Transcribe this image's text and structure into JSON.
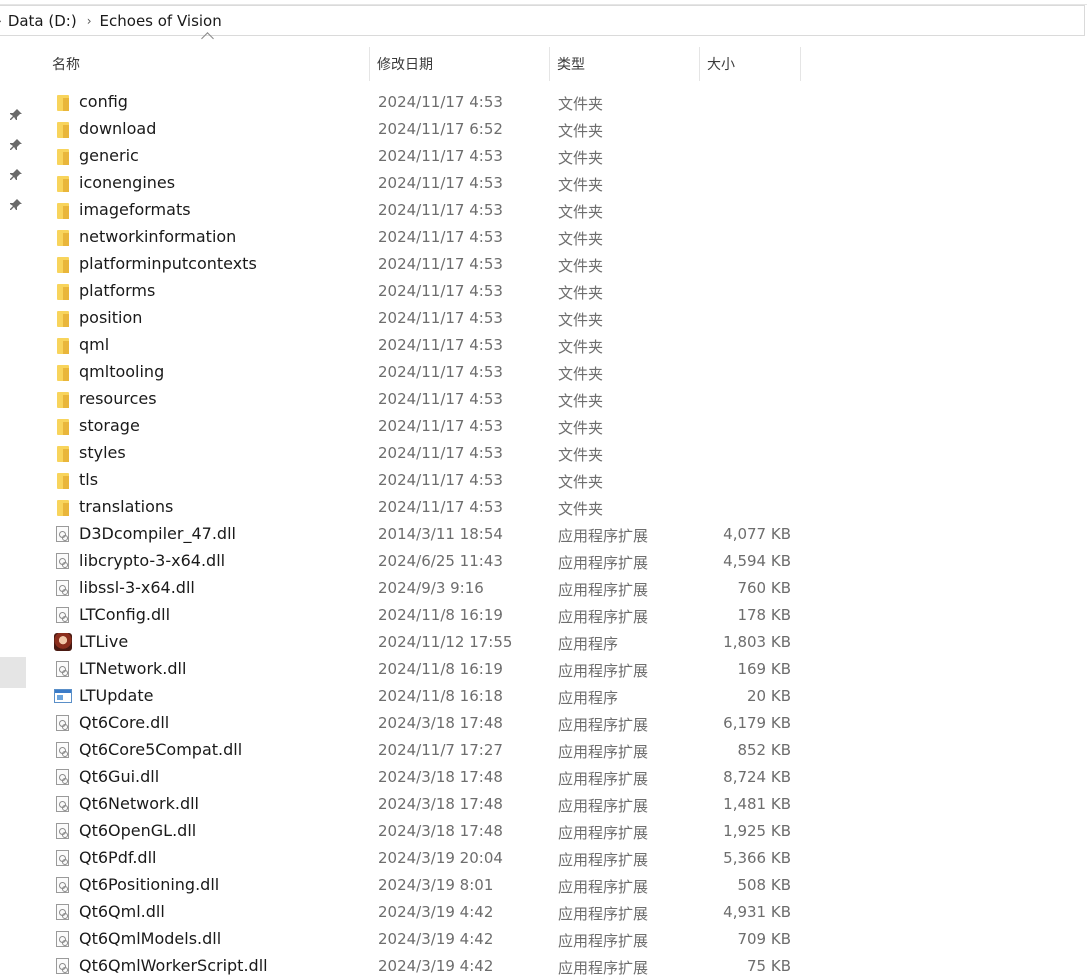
{
  "breadcrumb": [
    "Data (D:)",
    "Echoes of Vision"
  ],
  "columns": {
    "name": "名称",
    "date": "修改日期",
    "type": "类型",
    "size": "大小"
  },
  "files": [
    {
      "name": "config",
      "date": "2024/11/17 4:53",
      "type": "文件夹",
      "size": "",
      "icon": "folder-icon"
    },
    {
      "name": "download",
      "date": "2024/11/17 6:52",
      "type": "文件夹",
      "size": "",
      "icon": "folder-icon"
    },
    {
      "name": "generic",
      "date": "2024/11/17 4:53",
      "type": "文件夹",
      "size": "",
      "icon": "folder-icon"
    },
    {
      "name": "iconengines",
      "date": "2024/11/17 4:53",
      "type": "文件夹",
      "size": "",
      "icon": "folder-icon"
    },
    {
      "name": "imageformats",
      "date": "2024/11/17 4:53",
      "type": "文件夹",
      "size": "",
      "icon": "folder-icon"
    },
    {
      "name": "networkinformation",
      "date": "2024/11/17 4:53",
      "type": "文件夹",
      "size": "",
      "icon": "folder-icon"
    },
    {
      "name": "platforminputcontexts",
      "date": "2024/11/17 4:53",
      "type": "文件夹",
      "size": "",
      "icon": "folder-icon"
    },
    {
      "name": "platforms",
      "date": "2024/11/17 4:53",
      "type": "文件夹",
      "size": "",
      "icon": "folder-icon"
    },
    {
      "name": "position",
      "date": "2024/11/17 4:53",
      "type": "文件夹",
      "size": "",
      "icon": "folder-icon"
    },
    {
      "name": "qml",
      "date": "2024/11/17 4:53",
      "type": "文件夹",
      "size": "",
      "icon": "folder-icon"
    },
    {
      "name": "qmltooling",
      "date": "2024/11/17 4:53",
      "type": "文件夹",
      "size": "",
      "icon": "folder-icon"
    },
    {
      "name": "resources",
      "date": "2024/11/17 4:53",
      "type": "文件夹",
      "size": "",
      "icon": "folder-icon"
    },
    {
      "name": "storage",
      "date": "2024/11/17 4:53",
      "type": "文件夹",
      "size": "",
      "icon": "folder-icon"
    },
    {
      "name": "styles",
      "date": "2024/11/17 4:53",
      "type": "文件夹",
      "size": "",
      "icon": "folder-icon"
    },
    {
      "name": "tls",
      "date": "2024/11/17 4:53",
      "type": "文件夹",
      "size": "",
      "icon": "folder-icon"
    },
    {
      "name": "translations",
      "date": "2024/11/17 4:53",
      "type": "文件夹",
      "size": "",
      "icon": "folder-icon"
    },
    {
      "name": "D3Dcompiler_47.dll",
      "date": "2014/3/11 18:54",
      "type": "应用程序扩展",
      "size": "4,077 KB",
      "icon": "dll-file-icon"
    },
    {
      "name": "libcrypto-3-x64.dll",
      "date": "2024/6/25 11:43",
      "type": "应用程序扩展",
      "size": "4,594 KB",
      "icon": "dll-file-icon"
    },
    {
      "name": "libssl-3-x64.dll",
      "date": "2024/9/3 9:16",
      "type": "应用程序扩展",
      "size": "760 KB",
      "icon": "dll-file-icon"
    },
    {
      "name": "LTConfig.dll",
      "date": "2024/11/8 16:19",
      "type": "应用程序扩展",
      "size": "178 KB",
      "icon": "dll-file-icon"
    },
    {
      "name": "LTLive",
      "date": "2024/11/12 17:55",
      "type": "应用程序",
      "size": "1,803 KB",
      "icon": "app-avatar-icon"
    },
    {
      "name": "LTNetwork.dll",
      "date": "2024/11/8 16:19",
      "type": "应用程序扩展",
      "size": "169 KB",
      "icon": "dll-file-icon"
    },
    {
      "name": "LTUpdate",
      "date": "2024/11/8 16:18",
      "type": "应用程序",
      "size": "20 KB",
      "icon": "app-window-icon"
    },
    {
      "name": "Qt6Core.dll",
      "date": "2024/3/18 17:48",
      "type": "应用程序扩展",
      "size": "6,179 KB",
      "icon": "dll-file-icon"
    },
    {
      "name": "Qt6Core5Compat.dll",
      "date": "2024/11/7 17:27",
      "type": "应用程序扩展",
      "size": "852 KB",
      "icon": "dll-file-icon"
    },
    {
      "name": "Qt6Gui.dll",
      "date": "2024/3/18 17:48",
      "type": "应用程序扩展",
      "size": "8,724 KB",
      "icon": "dll-file-icon"
    },
    {
      "name": "Qt6Network.dll",
      "date": "2024/3/18 17:48",
      "type": "应用程序扩展",
      "size": "1,481 KB",
      "icon": "dll-file-icon"
    },
    {
      "name": "Qt6OpenGL.dll",
      "date": "2024/3/18 17:48",
      "type": "应用程序扩展",
      "size": "1,925 KB",
      "icon": "dll-file-icon"
    },
    {
      "name": "Qt6Pdf.dll",
      "date": "2024/3/19 20:04",
      "type": "应用程序扩展",
      "size": "5,366 KB",
      "icon": "dll-file-icon"
    },
    {
      "name": "Qt6Positioning.dll",
      "date": "2024/3/19 8:01",
      "type": "应用程序扩展",
      "size": "508 KB",
      "icon": "dll-file-icon"
    },
    {
      "name": "Qt6Qml.dll",
      "date": "2024/3/19 4:42",
      "type": "应用程序扩展",
      "size": "4,931 KB",
      "icon": "dll-file-icon"
    },
    {
      "name": "Qt6QmlModels.dll",
      "date": "2024/3/19 4:42",
      "type": "应用程序扩展",
      "size": "709 KB",
      "icon": "dll-file-icon"
    },
    {
      "name": "Qt6QmlWorkerScript.dll",
      "date": "2024/3/19 4:42",
      "type": "应用程序扩展",
      "size": "75 KB",
      "icon": "dll-file-icon"
    }
  ],
  "colors": {
    "folder": "#f8d45c",
    "folder_shade": "#e9b63b",
    "secondary_text": "#6d6d6d",
    "border": "#e5e5e5"
  }
}
